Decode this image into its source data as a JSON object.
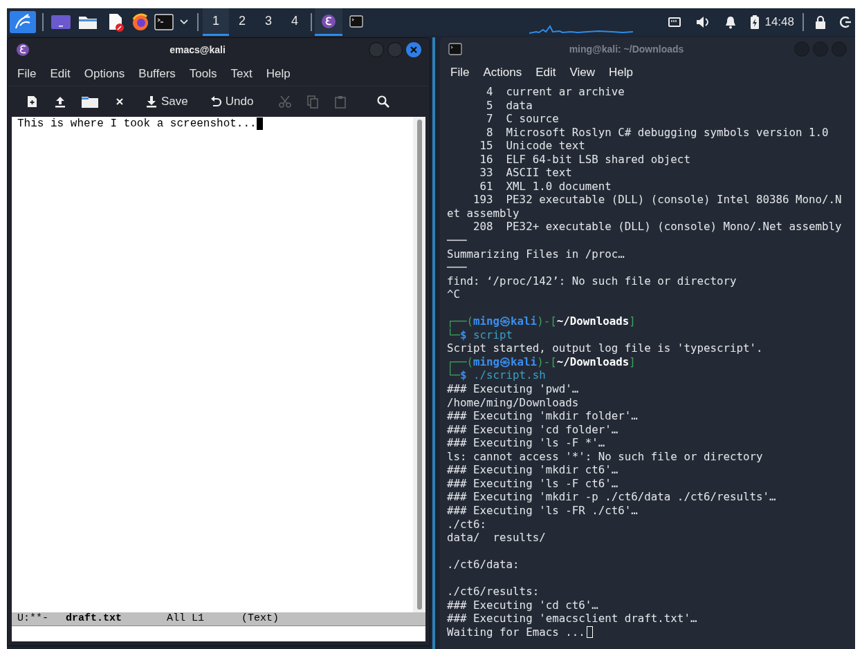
{
  "taskbar": {
    "workspaces": [
      {
        "label": "1",
        "selected": true
      },
      {
        "label": "2",
        "selected": false
      },
      {
        "label": "3",
        "selected": false
      },
      {
        "label": "4",
        "selected": false
      }
    ],
    "windows": [
      {
        "kind": "emacs",
        "selected": true
      },
      {
        "kind": "terminal",
        "selected": false
      }
    ],
    "clock": "14:48"
  },
  "emacs": {
    "title": "emacs@kali",
    "menu": [
      "File",
      "Edit",
      "Options",
      "Buffers",
      "Tools",
      "Text",
      "Help"
    ],
    "toolbar": [
      {
        "kind": "new",
        "disabled": false
      },
      {
        "kind": "upload",
        "disabled": false
      },
      {
        "kind": "folder",
        "disabled": false
      },
      {
        "kind": "close",
        "disabled": false
      },
      {
        "kind": "save",
        "label": "Save",
        "disabled": false
      },
      {
        "kind": "undo",
        "label": "Undo",
        "disabled": false
      },
      {
        "kind": "cut",
        "disabled": true
      },
      {
        "kind": "copy",
        "disabled": true
      },
      {
        "kind": "paste",
        "disabled": true
      },
      {
        "kind": "search",
        "disabled": false
      }
    ],
    "buffer_text": "This is where I took a screenshot...",
    "mode_line": {
      "state": "U:**-",
      "buffer": "draft.txt",
      "position": "All L1",
      "mode": "(Text)"
    }
  },
  "terminal": {
    "title": "ming@kali: ~/Downloads",
    "menu": [
      "File",
      "Actions",
      "Edit",
      "View",
      "Help"
    ],
    "lines": [
      {
        "kind": "out",
        "text": "      4  current ar archive"
      },
      {
        "kind": "out",
        "text": "      5  data"
      },
      {
        "kind": "out",
        "text": "      7  C source"
      },
      {
        "kind": "out",
        "text": "      8  Microsoft Roslyn C# debugging symbols version 1.0"
      },
      {
        "kind": "out",
        "text": "     15  Unicode text"
      },
      {
        "kind": "out",
        "text": "     16  ELF 64-bit LSB shared object"
      },
      {
        "kind": "out",
        "text": "     33  ASCII text"
      },
      {
        "kind": "out",
        "text": "     61  XML 1.0 document"
      },
      {
        "kind": "out",
        "text": "    193  PE32 executable (DLL) (console) Intel 80386 Mono/.N"
      },
      {
        "kind": "out",
        "text": "et assembly"
      },
      {
        "kind": "out",
        "text": "    208  PE32+ executable (DLL) (console) Mono/.Net assembly"
      },
      {
        "kind": "out",
        "text": "───"
      },
      {
        "kind": "out",
        "text": "Summarizing Files in /proc…"
      },
      {
        "kind": "out",
        "text": "───"
      },
      {
        "kind": "out",
        "text": "find: ‘/proc/142’: No such file or directory"
      },
      {
        "kind": "out",
        "text": "^C"
      },
      {
        "kind": "blank"
      },
      {
        "kind": "prompt",
        "corner": "┌──(",
        "user": "ming㉿kali",
        "mid": ")-[",
        "dir": "~/Downloads",
        "end": "]"
      },
      {
        "kind": "cmd",
        "corner": "└─",
        "sign": "$",
        "text": "script"
      },
      {
        "kind": "out",
        "text": "Script started, output log file is 'typescript'."
      },
      {
        "kind": "prompt",
        "corner": "┌──(",
        "user": "ming㉿kali",
        "mid": ")-[",
        "dir": "~/Downloads",
        "end": "]"
      },
      {
        "kind": "cmd",
        "corner": "└─",
        "sign": "$",
        "text": "./script.sh"
      },
      {
        "kind": "out",
        "text": "### Executing 'pwd'…"
      },
      {
        "kind": "out",
        "text": "/home/ming/Downloads"
      },
      {
        "kind": "out",
        "text": "### Executing 'mkdir folder'…"
      },
      {
        "kind": "out",
        "text": "### Executing 'cd folder'…"
      },
      {
        "kind": "out",
        "text": "### Executing 'ls -F *'…"
      },
      {
        "kind": "out",
        "text": "ls: cannot access '*': No such file or directory"
      },
      {
        "kind": "out",
        "text": "### Executing 'mkdir ct6'…"
      },
      {
        "kind": "out",
        "text": "### Executing 'ls -F ct6'…"
      },
      {
        "kind": "out",
        "text": "### Executing 'mkdir -p ./ct6/data ./ct6/results'…"
      },
      {
        "kind": "out",
        "text": "### Executing 'ls -FR ./ct6'…"
      },
      {
        "kind": "out",
        "text": "./ct6:"
      },
      {
        "kind": "out",
        "text": "data/  results/"
      },
      {
        "kind": "blank"
      },
      {
        "kind": "out",
        "text": "./ct6/data:"
      },
      {
        "kind": "blank"
      },
      {
        "kind": "out",
        "text": "./ct6/results:"
      },
      {
        "kind": "out",
        "text": "### Executing 'cd ct6'…"
      },
      {
        "kind": "out",
        "text": "### Executing 'emacsclient draft.txt'…"
      },
      {
        "kind": "waiting",
        "text": "Waiting for Emacs ..."
      }
    ]
  }
}
